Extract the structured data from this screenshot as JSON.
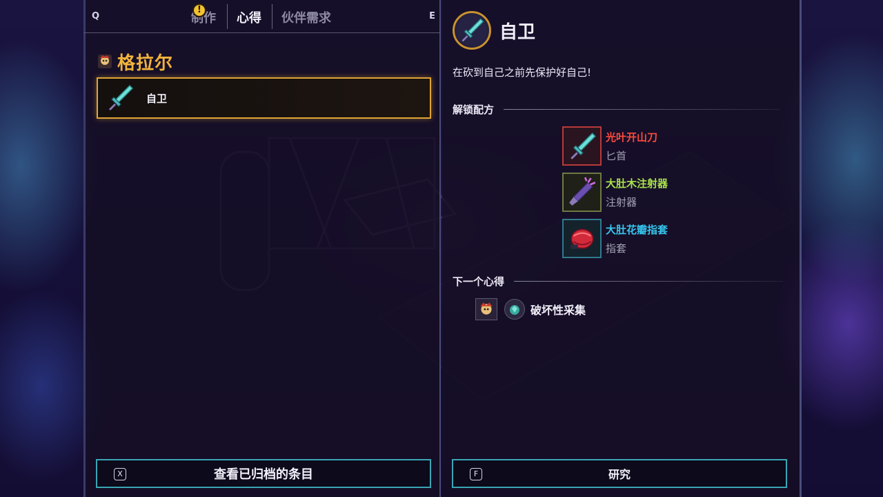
{
  "tabs": {
    "key_prev": "Q",
    "key_next": "E",
    "items": [
      {
        "label": "制作"
      },
      {
        "label": "心得"
      },
      {
        "label": "伙伴需求"
      }
    ]
  },
  "character": {
    "name": "格拉尔"
  },
  "entries": [
    {
      "label": "自卫"
    }
  ],
  "detail": {
    "title": "自卫",
    "description": "在砍到自己之前先保护好自己!",
    "unlock_heading": "解锁配方",
    "recipes": [
      {
        "name": "光叶开山刀",
        "type": "匕首",
        "color": "#ff4a3c"
      },
      {
        "name": "大肚木注射器",
        "type": "注射器",
        "color": "#a9e24a"
      },
      {
        "name": "大肚花瓣指套",
        "type": "指套",
        "color": "#36c6ee"
      }
    ],
    "next_heading": "下一个心得",
    "next_label": "破坏性采集"
  },
  "buttons": {
    "archived_key": "X",
    "archived_label": "查看已归档的条目",
    "research_key": "F",
    "research_label": "研究"
  },
  "colors": {
    "accent_gold": "#e0a534",
    "button_border": "#3aa7b5",
    "character_name": "#f2b33c"
  }
}
